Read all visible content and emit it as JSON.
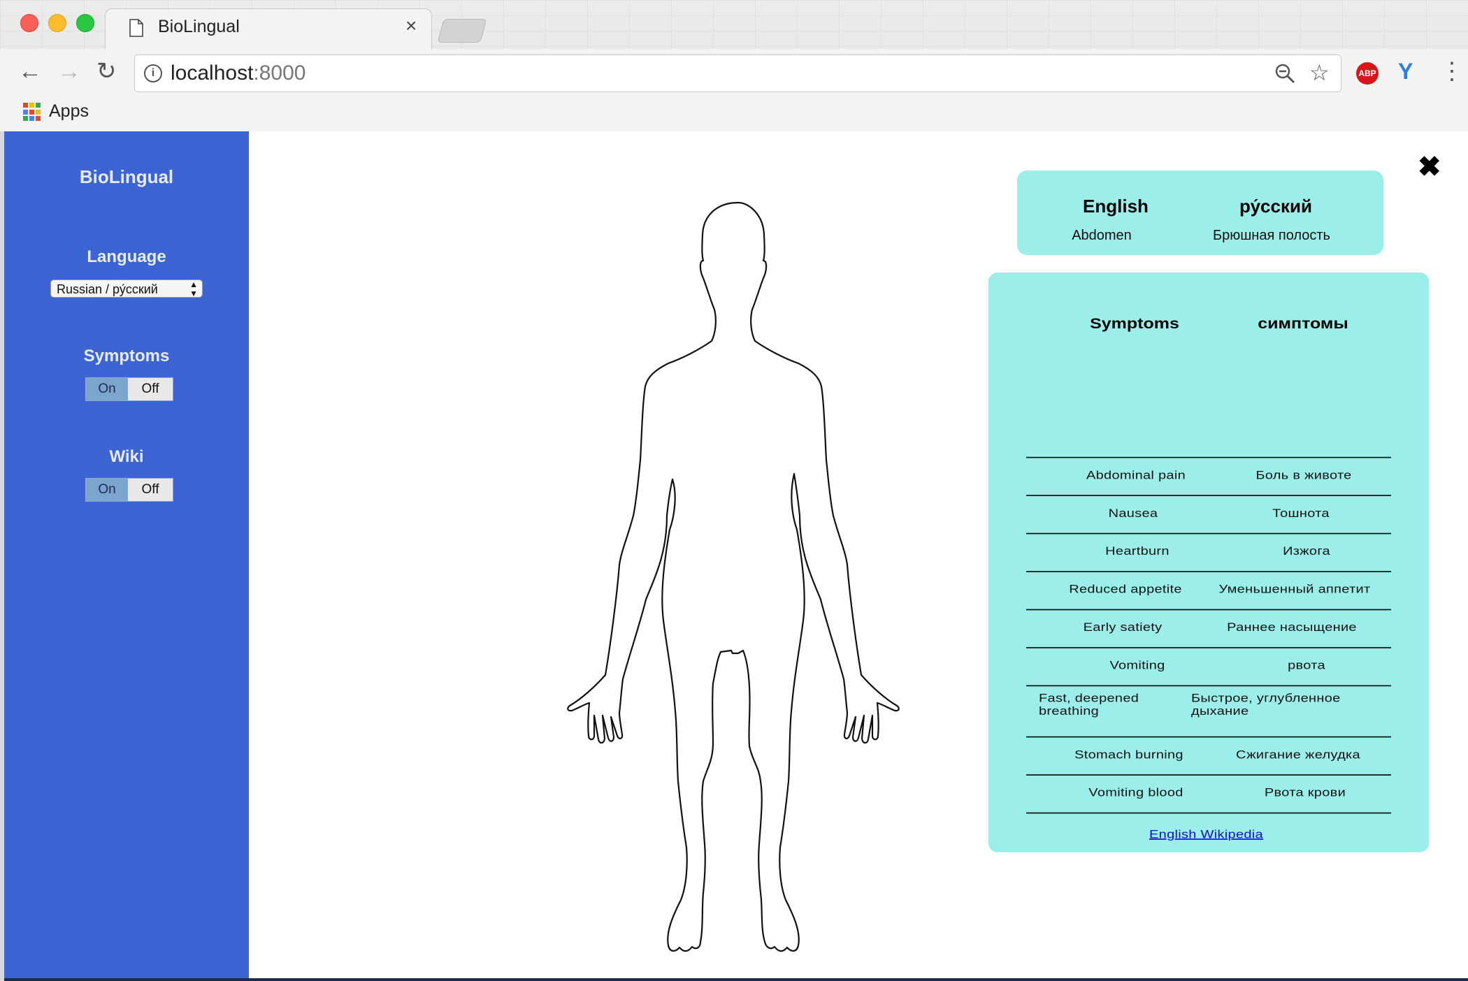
{
  "browser": {
    "tab_title": "BioLingual",
    "tab_close": "×",
    "url_host": "localhost",
    "url_port": ":8000",
    "bookmarks_apps": "Apps",
    "abp": "ABP"
  },
  "sidebar": {
    "brand": "BioLingual",
    "language_label": "Language",
    "language_value": "Russian / ру́сский",
    "symptoms_label": "Symptoms",
    "wiki_label": "Wiki",
    "toggle_on": "On",
    "toggle_off": "Off"
  },
  "term": {
    "english_header": "English",
    "russian_header": "ру́сский",
    "english_value": "Abdomen",
    "russian_value": "Брюшная полость"
  },
  "symptoms": {
    "english_header": "Symptoms",
    "russian_header": "симптомы",
    "rows": [
      {
        "en": "Abdominal pain",
        "ru": "Боль в животе"
      },
      {
        "en": "Nausea",
        "ru": "Тошнота"
      },
      {
        "en": "Heartburn",
        "ru": "Изжога"
      },
      {
        "en": "Reduced appetite",
        "ru": "Уменьшенный аппетит"
      },
      {
        "en": "Early satiety",
        "ru": "Раннее насыщение"
      },
      {
        "en": "Vomiting",
        "ru": "рвота"
      },
      {
        "en": "Fast, deepened breathing",
        "ru": "Быстрое, углубленное дыхание"
      },
      {
        "en": "Stomach burning",
        "ru": "Сжигание желудка"
      },
      {
        "en": "Vomiting blood",
        "ru": "Рвота крови"
      }
    ],
    "wiki_link": "English Wikipedia"
  },
  "close_label": "✖",
  "colors": {
    "sidebar": "#3c64d2",
    "card": "#9ceeea"
  }
}
